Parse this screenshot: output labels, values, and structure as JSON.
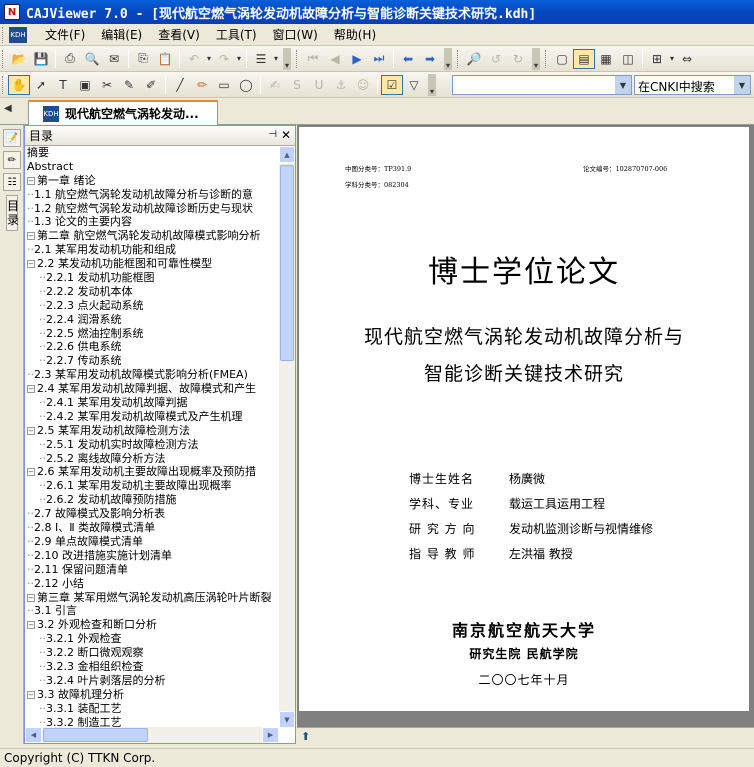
{
  "window": {
    "title": "CAJViewer 7.0 - [现代航空燃气涡轮发动机故障分析与智能诊断关键技术研究.kdh]"
  },
  "menu": [
    "文件(F)",
    "编辑(E)",
    "查看(V)",
    "工具(T)",
    "窗口(W)",
    "帮助(H)"
  ],
  "toolbar": {
    "search_value": "",
    "search_scope": "在CNKI中搜索"
  },
  "tab": {
    "label": "现代航空燃气涡轮发动..."
  },
  "sidebar": {
    "vertical_label": "目录"
  },
  "toc": {
    "header": "目录",
    "items": [
      {
        "level": 0,
        "text": "摘要",
        "exp": ""
      },
      {
        "level": 0,
        "text": "Abstract",
        "exp": ""
      },
      {
        "level": 0,
        "text": "第一章 绪论",
        "exp": "−"
      },
      {
        "level": 1,
        "text": "1.1 航空燃气涡轮发动机故障分析与诊断的意",
        "exp": ""
      },
      {
        "level": 1,
        "text": "1.2 航空燃气涡轮发动机故障诊断历史与现状",
        "exp": ""
      },
      {
        "level": 1,
        "text": "1.3 论文的主要内容",
        "exp": ""
      },
      {
        "level": 0,
        "text": "第二章 航空燃气涡轮发动机故障模式影响分析",
        "exp": "−"
      },
      {
        "level": 1,
        "text": "2.1 某军用发动机功能和组成",
        "exp": ""
      },
      {
        "level": 1,
        "text": "2.2 某发动机功能框图和可靠性模型",
        "exp": "−"
      },
      {
        "level": 2,
        "text": "2.2.1 发动机功能框图",
        "exp": ""
      },
      {
        "level": 2,
        "text": "2.2.2 发动机本体",
        "exp": ""
      },
      {
        "level": 2,
        "text": "2.2.3 点火起动系统",
        "exp": ""
      },
      {
        "level": 2,
        "text": "2.2.4 润滑系统",
        "exp": ""
      },
      {
        "level": 2,
        "text": "2.2.5 燃油控制系统",
        "exp": ""
      },
      {
        "level": 2,
        "text": "2.2.6 供电系统",
        "exp": ""
      },
      {
        "level": 2,
        "text": "2.2.7 传动系统",
        "exp": ""
      },
      {
        "level": 1,
        "text": "2.3 某军用发动机故障模式影响分析(FMEA)",
        "exp": ""
      },
      {
        "level": 1,
        "text": "2.4 某军用发动机故障判据、故障模式和产生",
        "exp": "−"
      },
      {
        "level": 2,
        "text": "2.4.1 某军用发动机故障判据",
        "exp": ""
      },
      {
        "level": 2,
        "text": "2.4.2 某军用发动机故障模式及产生机理",
        "exp": ""
      },
      {
        "level": 1,
        "text": "2.5 某军用发动机故障检测方法",
        "exp": "−"
      },
      {
        "level": 2,
        "text": "2.5.1 发动机实时故障检测方法",
        "exp": ""
      },
      {
        "level": 2,
        "text": "2.5.2 离线故障分析方法",
        "exp": ""
      },
      {
        "level": 1,
        "text": "2.6 某军用发动机主要故障出现概率及预防措",
        "exp": "−"
      },
      {
        "level": 2,
        "text": "2.6.1 某军用发动机主要故障出现概率",
        "exp": ""
      },
      {
        "level": 2,
        "text": "2.6.2 发动机故障预防措施",
        "exp": ""
      },
      {
        "level": 1,
        "text": "2.7 故障模式及影响分析表",
        "exp": ""
      },
      {
        "level": 1,
        "text": "2.8 Ⅰ、Ⅱ 类故障模式清单",
        "exp": ""
      },
      {
        "level": 1,
        "text": "2.9 单点故障模式清单",
        "exp": ""
      },
      {
        "level": 1,
        "text": "2.10 改进措施实施计划清单",
        "exp": ""
      },
      {
        "level": 1,
        "text": "2.11 保留问题清单",
        "exp": ""
      },
      {
        "level": 1,
        "text": "2.12 小结",
        "exp": ""
      },
      {
        "level": 0,
        "text": "第三章 某军用燃气涡轮发动机高压涡轮叶片断裂",
        "exp": "−"
      },
      {
        "level": 1,
        "text": "3.1 引言",
        "exp": ""
      },
      {
        "level": 1,
        "text": "3.2 外观检查和断口分析",
        "exp": "−"
      },
      {
        "level": 2,
        "text": "3.2.1 外观检查",
        "exp": ""
      },
      {
        "level": 2,
        "text": "3.2.2 断口微观观察",
        "exp": ""
      },
      {
        "level": 2,
        "text": "3.2.3 金相组织检查",
        "exp": ""
      },
      {
        "level": 2,
        "text": "3.2.4 叶片剥落层的分析",
        "exp": ""
      },
      {
        "level": 1,
        "text": "3.3 故障机理分析",
        "exp": "−"
      },
      {
        "level": 2,
        "text": "3.3.1 装配工艺",
        "exp": ""
      },
      {
        "level": 2,
        "text": "3.3.2 制造工艺",
        "exp": ""
      }
    ]
  },
  "page": {
    "class_no": "中图分类号：TP391.9",
    "paper_no": "论文编号：102870707-006",
    "subject_no": "学科分类号：082304",
    "title": "博士学位论文",
    "subtitle_1": "现代航空燃气涡轮发动机故障分析与",
    "subtitle_2": "智能诊断关键技术研究",
    "info": [
      {
        "k": "博士生姓名",
        "v": "杨廣微"
      },
      {
        "k": "学科、专业",
        "v": "载运工具运用工程"
      },
      {
        "k": "研 究 方 向",
        "v": "发动机监测诊断与视情维修"
      },
      {
        "k": "指 导 教 师",
        "v": "左洪福 教授"
      }
    ],
    "university": "南京航空航天大学",
    "college": "研究生院 民航学院",
    "date": "二〇〇七年十月"
  },
  "status": "Copyright (C) TTKN Corp."
}
